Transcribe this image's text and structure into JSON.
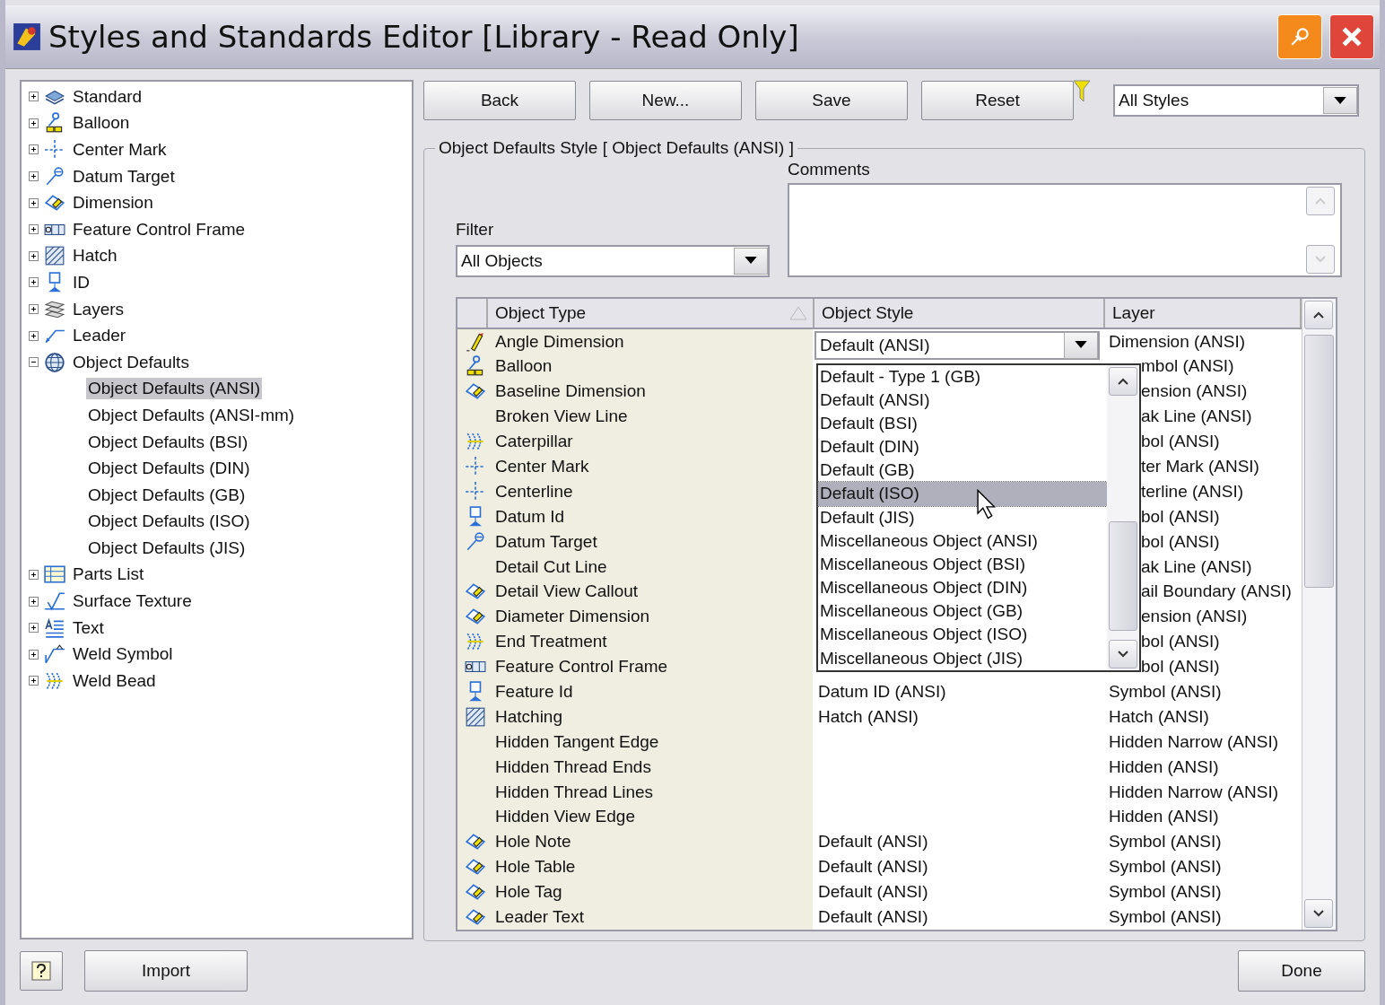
{
  "window": {
    "title": "Styles and Standards Editor [Library - Read Only]"
  },
  "tree": [
    {
      "label": "Standard",
      "kind": "standard",
      "expanded": false,
      "selected": false
    },
    {
      "label": "Balloon",
      "kind": "balloon",
      "expanded": false,
      "selected": false
    },
    {
      "label": "Center Mark",
      "kind": "center",
      "expanded": false,
      "selected": false
    },
    {
      "label": "Datum Target",
      "kind": "datum-target",
      "expanded": false,
      "selected": false
    },
    {
      "label": "Dimension",
      "kind": "dimension",
      "expanded": false,
      "selected": false
    },
    {
      "label": "Feature Control Frame",
      "kind": "fcf",
      "expanded": false,
      "selected": false
    },
    {
      "label": "Hatch",
      "kind": "hatch",
      "expanded": false,
      "selected": false
    },
    {
      "label": "ID",
      "kind": "datum-id",
      "expanded": false,
      "selected": false
    },
    {
      "label": "Layers",
      "kind": "layers",
      "expanded": false,
      "selected": false
    },
    {
      "label": "Leader",
      "kind": "leader",
      "expanded": false,
      "selected": false
    },
    {
      "label": "Object Defaults",
      "kind": "globe",
      "expanded": true,
      "selected": false,
      "children": [
        {
          "label": "Object Defaults (ANSI)",
          "selected": true
        },
        {
          "label": "Object Defaults (ANSI-mm)",
          "selected": false
        },
        {
          "label": "Object Defaults (BSI)",
          "selected": false
        },
        {
          "label": "Object Defaults (DIN)",
          "selected": false
        },
        {
          "label": "Object Defaults (GB)",
          "selected": false
        },
        {
          "label": "Object Defaults (ISO)",
          "selected": false
        },
        {
          "label": "Object Defaults (JIS)",
          "selected": false
        }
      ]
    },
    {
      "label": "Parts List",
      "kind": "parts-list",
      "expanded": false,
      "selected": false
    },
    {
      "label": "Surface Texture",
      "kind": "surface",
      "expanded": false,
      "selected": false
    },
    {
      "label": "Text",
      "kind": "text",
      "expanded": false,
      "selected": false
    },
    {
      "label": "Weld Symbol",
      "kind": "weld",
      "expanded": false,
      "selected": false
    },
    {
      "label": "Weld Bead",
      "kind": "caterpillar",
      "expanded": false,
      "selected": false
    }
  ],
  "toolbar": {
    "buttons": [
      "Back",
      "New...",
      "Save",
      "Reset"
    ],
    "style_filter": {
      "value": "All Styles"
    }
  },
  "panel": {
    "title": "Object Defaults Style [ Object Defaults (ANSI) ]",
    "filter": {
      "label": "Filter",
      "value": "All Objects"
    },
    "comments": {
      "label": "Comments"
    }
  },
  "table": {
    "columns": [
      "Object Type",
      "Object Style",
      "Layer"
    ],
    "rows": [
      {
        "kind": "pencil",
        "type": "Angle Dimension",
        "style": "Default (ANSI)",
        "editing": true,
        "layer": "Dimension (ANSI)"
      },
      {
        "kind": "balloon",
        "type": "Balloon",
        "layer": "mbol (ANSI)"
      },
      {
        "kind": "dimension",
        "type": "Baseline Dimension",
        "layer": "ension (ANSI)"
      },
      {
        "kind": "none",
        "type": "Broken View Line",
        "layer": "ak Line (ANSI)"
      },
      {
        "kind": "caterpillar",
        "type": "Caterpillar",
        "layer": "bol (ANSI)"
      },
      {
        "kind": "center",
        "type": "Center Mark",
        "layer": "ter Mark (ANSI)"
      },
      {
        "kind": "center",
        "type": "Centerline",
        "layer": "terline (ANSI)"
      },
      {
        "kind": "datum-id",
        "type": "Datum Id",
        "layer": "bol (ANSI)"
      },
      {
        "kind": "datum-target",
        "type": "Datum Target",
        "layer": "bol (ANSI)"
      },
      {
        "kind": "none",
        "type": "Detail Cut Line",
        "layer": "ak Line (ANSI)"
      },
      {
        "kind": "dimension",
        "type": "Detail View Callout",
        "layer": "ail Boundary (ANSI)"
      },
      {
        "kind": "dimension",
        "type": "Diameter Dimension",
        "layer": "ension (ANSI)"
      },
      {
        "kind": "caterpillar",
        "type": "End Treatment",
        "layer": "bol (ANSI)"
      },
      {
        "kind": "fcf",
        "type": "Feature Control Frame",
        "layer": "bol (ANSI)"
      },
      {
        "kind": "datum-id",
        "type": "Feature Id",
        "style": "Datum ID (ANSI)",
        "editing": false,
        "layer": "Symbol (ANSI)"
      },
      {
        "kind": "hatch",
        "type": "Hatching",
        "style": "Hatch (ANSI)",
        "editing": false,
        "layer": "Hatch (ANSI)"
      },
      {
        "kind": "none",
        "type": "Hidden Tangent Edge",
        "layer": "Hidden Narrow (ANSI)"
      },
      {
        "kind": "none",
        "type": "Hidden Thread Ends",
        "layer": "Hidden (ANSI)"
      },
      {
        "kind": "none",
        "type": "Hidden Thread Lines",
        "layer": "Hidden Narrow (ANSI)"
      },
      {
        "kind": "none",
        "type": "Hidden View Edge",
        "layer": "Hidden (ANSI)"
      },
      {
        "kind": "dimension",
        "type": "Hole Note",
        "style": "Default (ANSI)",
        "editing": false,
        "layer": "Symbol (ANSI)"
      },
      {
        "kind": "dimension",
        "type": "Hole Table",
        "style": "Default (ANSI)",
        "editing": false,
        "layer": "Symbol (ANSI)"
      },
      {
        "kind": "dimension",
        "type": "Hole Tag",
        "style": "Default (ANSI)",
        "editing": false,
        "layer": "Symbol (ANSI)"
      },
      {
        "kind": "dimension",
        "type": "Leader Text",
        "style": "Default (ANSI)",
        "editing": false,
        "layer": "Symbol (ANSI)"
      }
    ],
    "dropdown_options": [
      {
        "label": "Default - Type 1 (GB)",
        "selected": false
      },
      {
        "label": "Default (ANSI)",
        "selected": false
      },
      {
        "label": "Default (BSI)",
        "selected": false
      },
      {
        "label": "Default (DIN)",
        "selected": false
      },
      {
        "label": "Default (GB)",
        "selected": false
      },
      {
        "label": "Default (ISO)",
        "selected": true
      },
      {
        "label": "Default (JIS)",
        "selected": false
      },
      {
        "label": "Miscellaneous Object (ANSI)",
        "selected": false
      },
      {
        "label": "Miscellaneous Object (BSI)",
        "selected": false
      },
      {
        "label": "Miscellaneous Object (DIN)",
        "selected": false
      },
      {
        "label": "Miscellaneous Object (GB)",
        "selected": false
      },
      {
        "label": "Miscellaneous Object (ISO)",
        "selected": false
      },
      {
        "label": "Miscellaneous Object (JIS)",
        "selected": false
      }
    ]
  },
  "footer": {
    "import": "Import",
    "done": "Done"
  }
}
